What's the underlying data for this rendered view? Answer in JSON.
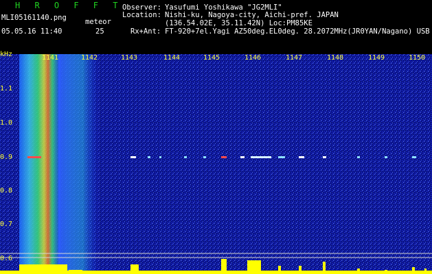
{
  "header": {
    "brand": "H R O F F T",
    "filename": "MLI05161140.png",
    "datetime": "05.05.16 11:40",
    "meteor_label": "meteor",
    "meteor_count": "25",
    "observer_label": "Observer:",
    "observer_value": "Yasufumi Yoshikawa \"JG2MLI\"",
    "location_label": "Location:",
    "location_value": "Nishi-ku, Nagoya-city, Aichi-pref. JAPAN",
    "location_coords": "(136.54.02E, 35.11.42N) Loc:PM85KE",
    "rx_label": "Rx+Ant:",
    "rx_value": "FT-920+7el.Yagi AZ50deg.EL0deg. 28.2072MHz(JR0YAN/Nagano) USB"
  },
  "axes": {
    "y_unit": "kHz",
    "y_ticks": [
      "1.1",
      "1.0",
      "0.9",
      "0.8",
      "0.7",
      "0.6"
    ],
    "x_ticks": [
      "1141",
      "1142",
      "1143",
      "1144",
      "1145",
      "1146",
      "1147",
      "1148",
      "1149",
      "1150"
    ]
  },
  "colors": {
    "background": "#000000",
    "brand": "#21d321",
    "labels": "#ffff3c",
    "text": "#ffffff",
    "noise": "#1a2cff"
  }
}
